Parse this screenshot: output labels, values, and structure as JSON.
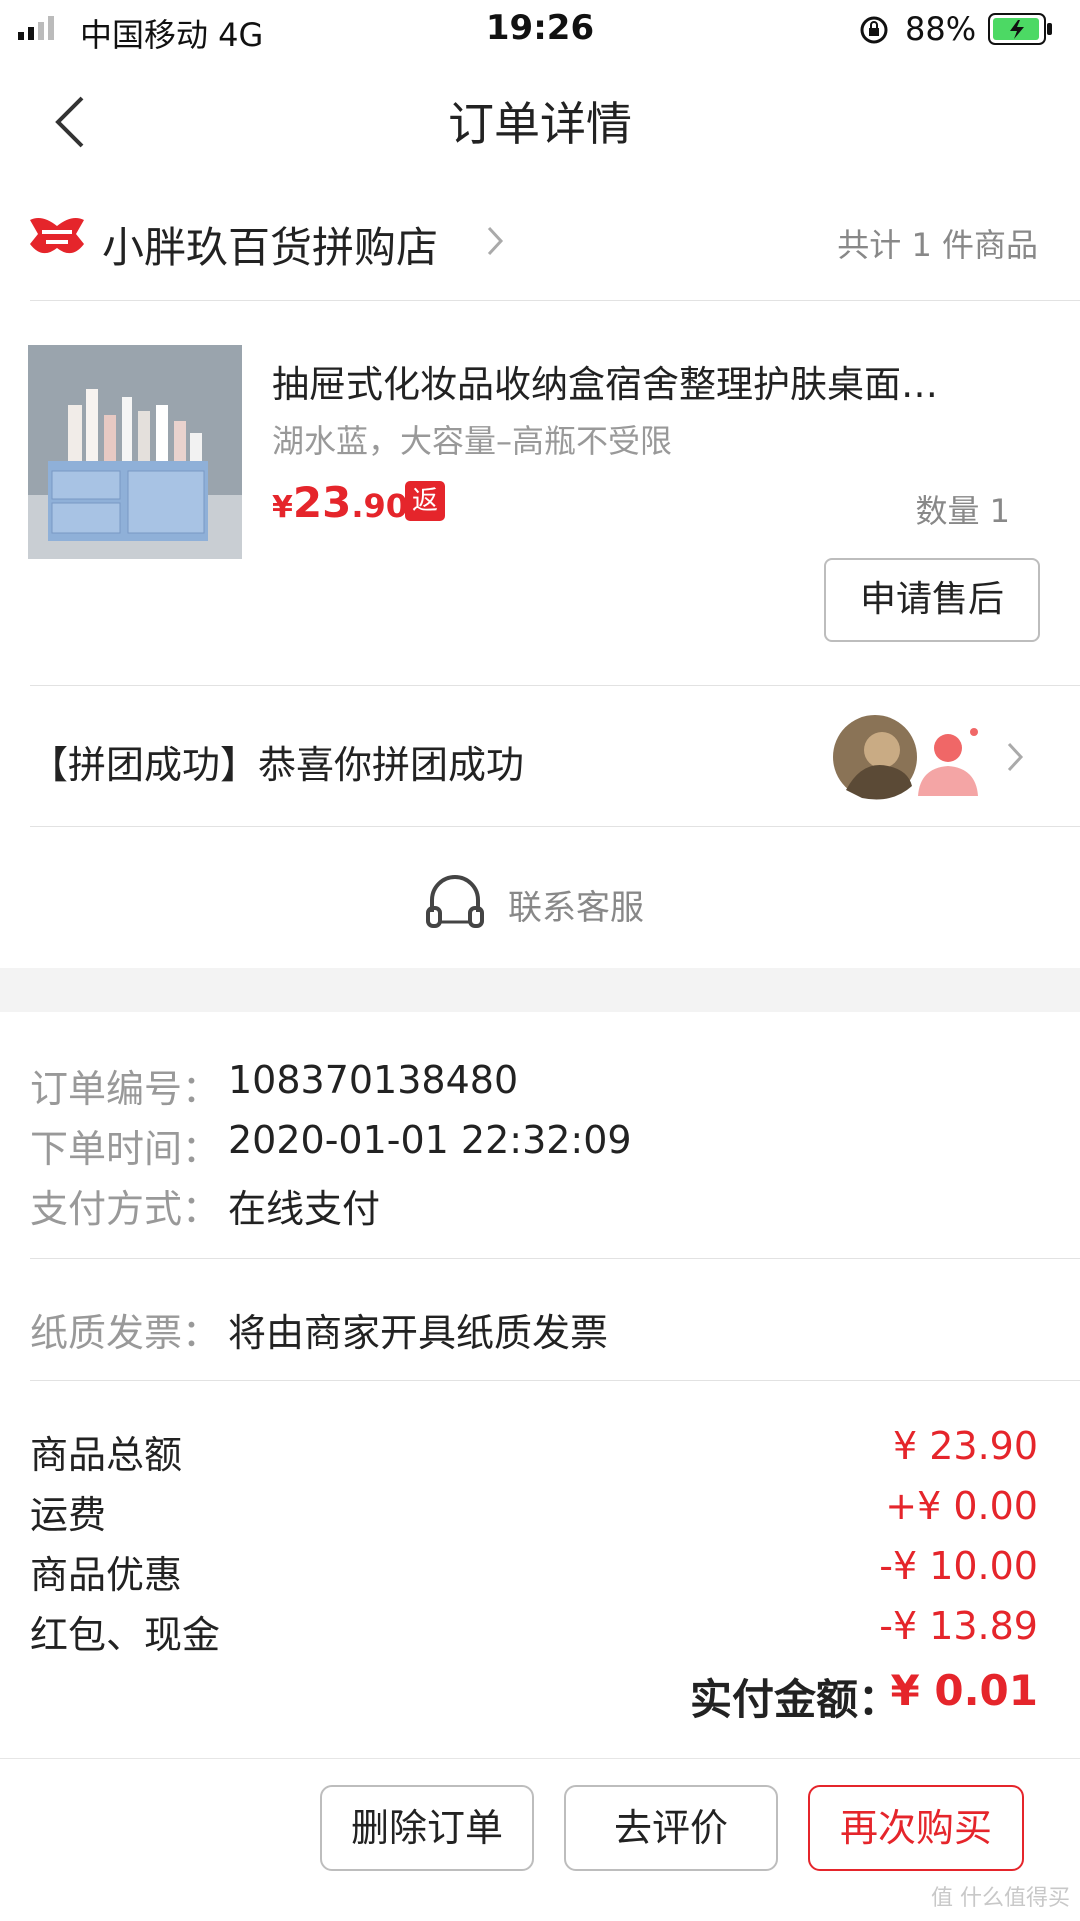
{
  "status_bar": {
    "carrier": "中国移动  4G",
    "time": "19:26",
    "battery": "88%"
  },
  "nav": {
    "title": "订单详情"
  },
  "shop": {
    "name": "小胖玖百货拼购店",
    "count": "共计 1 件商品",
    "logo_color": "#e5252b"
  },
  "product": {
    "title": "抽屉式化妆品收纳盒宿舍整理护肤桌面…",
    "spec": "湖水蓝，大容量–高瓶不受限",
    "price_currency": "¥",
    "price_int": "23",
    "price_dec": ".90",
    "rebate_badge": "返",
    "quantity": "数量 1",
    "aftersale_button": "申请售后"
  },
  "group": {
    "text": "【拼团成功】恭喜你拼团成功"
  },
  "contact": {
    "label": "联系客服",
    "icon": "headset-icon"
  },
  "order_info": [
    {
      "label": "订单编号：",
      "value": "108370138480"
    },
    {
      "label": "下单时间：",
      "value": "2020-01-01 22:32:09"
    },
    {
      "label": "支付方式：",
      "value": "在线支付"
    }
  ],
  "invoice": {
    "label": "纸质发票：",
    "value": "将由商家开具纸质发票"
  },
  "amounts": [
    {
      "label": "商品总额",
      "value": "¥ 23.90"
    },
    {
      "label": "运费",
      "value": "+¥ 0.00"
    },
    {
      "label": "商品优惠",
      "value": "-¥ 10.00"
    },
    {
      "label": "红包、现金",
      "value": "-¥ 13.89"
    }
  ],
  "paid": {
    "label": "实付金额：",
    "value": "¥ 0.01"
  },
  "bottom": {
    "delete_button": "删除订单",
    "review_button": "去评价",
    "rebuy_button": "再次购买"
  },
  "watermark": "值 什么值得买",
  "colors": {
    "accent": "#e5252b",
    "muted": "#999999"
  }
}
